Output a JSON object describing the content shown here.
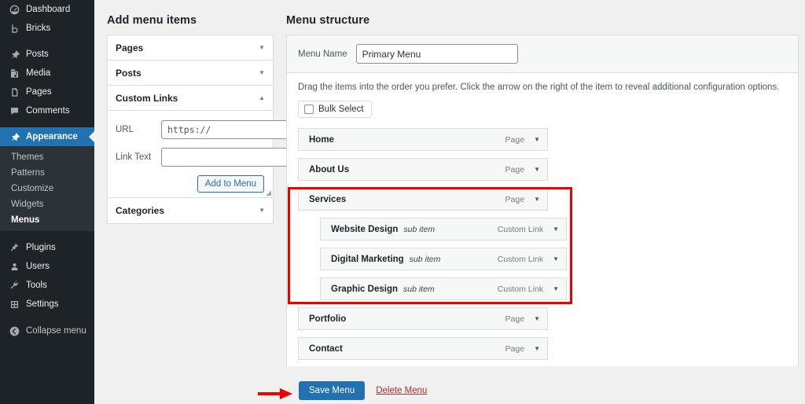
{
  "sidebar": {
    "items": [
      {
        "label": "Dashboard",
        "icon": "dashboard-icon",
        "name": "sidebar-item-dashboard"
      },
      {
        "label": "Bricks",
        "icon": "bricks-icon",
        "name": "sidebar-item-bricks"
      },
      {
        "label": "Posts",
        "icon": "pin-icon",
        "name": "sidebar-item-posts"
      },
      {
        "label": "Media",
        "icon": "media-icon",
        "name": "sidebar-item-media"
      },
      {
        "label": "Pages",
        "icon": "pages-icon",
        "name": "sidebar-item-pages"
      },
      {
        "label": "Comments",
        "icon": "comments-icon",
        "name": "sidebar-item-comments"
      },
      {
        "label": "Appearance",
        "icon": "brush-icon",
        "name": "sidebar-item-appearance"
      },
      {
        "label": "Plugins",
        "icon": "plugins-icon",
        "name": "sidebar-item-plugins"
      },
      {
        "label": "Users",
        "icon": "users-icon",
        "name": "sidebar-item-users"
      },
      {
        "label": "Tools",
        "icon": "wrench-icon",
        "name": "sidebar-item-tools"
      },
      {
        "label": "Settings",
        "icon": "settings-icon",
        "name": "sidebar-item-settings"
      }
    ],
    "current_item": "Appearance",
    "submenu": [
      {
        "label": "Themes"
      },
      {
        "label": "Patterns"
      },
      {
        "label": "Customize"
      },
      {
        "label": "Widgets"
      },
      {
        "label": "Menus"
      }
    ],
    "active_submenu": "Menus",
    "collapse": {
      "label": "Collapse menu",
      "icon": "collapse-arrow-icon"
    },
    "accent_color": "#2271b1",
    "background_color": "#1d2327"
  },
  "add_menu_items": {
    "title": "Add menu items",
    "sections": [
      {
        "label": "Pages",
        "expanded": false,
        "caret": "▼"
      },
      {
        "label": "Posts",
        "expanded": false,
        "caret": "▼"
      },
      {
        "label": "Custom Links",
        "expanded": true,
        "caret": "▲"
      },
      {
        "label": "Categories",
        "expanded": false,
        "caret": "▼"
      }
    ],
    "custom_links": {
      "url_label": "URL",
      "url_value": "https://",
      "link_text_label": "Link Text",
      "link_text_value": "",
      "link_text_placeholder": "",
      "add_button": "Add to Menu"
    }
  },
  "menu_structure": {
    "title": "Menu structure",
    "menu_name_label": "Menu Name",
    "menu_name_value": "Primary Menu",
    "drag_hint": "Drag the items into the order you prefer. Click the arrow on the right of the item to reveal additional configuration options.",
    "bulk_select_label": "Bulk Select",
    "items": [
      {
        "title": "Home",
        "sublabel": "",
        "type": "Page",
        "depth": 0,
        "caret": "▼"
      },
      {
        "title": "About Us",
        "sublabel": "",
        "type": "Page",
        "depth": 0,
        "caret": "▼"
      },
      {
        "title": "Services",
        "sublabel": "",
        "type": "Page",
        "depth": 0,
        "caret": "▼"
      },
      {
        "title": "Website Design",
        "sublabel": "sub item",
        "type": "Custom Link",
        "depth": 1,
        "caret": "▼"
      },
      {
        "title": "Digital Marketing",
        "sublabel": "sub item",
        "type": "Custom Link",
        "depth": 1,
        "caret": "▼"
      },
      {
        "title": "Graphic Design",
        "sublabel": "sub item",
        "type": "Custom Link",
        "depth": 1,
        "caret": "▼"
      },
      {
        "title": "Portfolio",
        "sublabel": "",
        "type": "Page",
        "depth": 0,
        "caret": "▼"
      },
      {
        "title": "Contact",
        "sublabel": "",
        "type": "Page",
        "depth": 0,
        "caret": "▼"
      }
    ],
    "save_label": "Save Menu",
    "delete_label": "Delete Menu"
  },
  "annotations": {
    "highlight_color": "#ee0000",
    "highlight_target": "Services submenu group",
    "arrow_target": "Save Menu"
  }
}
